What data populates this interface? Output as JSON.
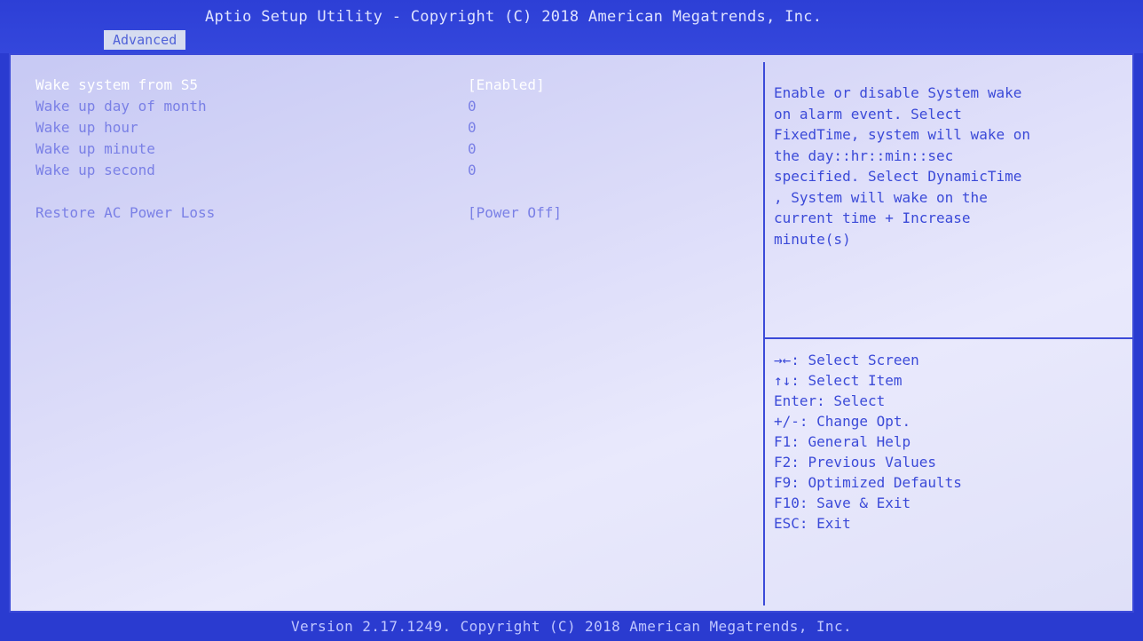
{
  "header": {
    "title": "Aptio Setup Utility - Copyright (C) 2018 American Megatrends, Inc.",
    "active_tab": "Advanced"
  },
  "settings": [
    {
      "label": "Wake system from S5",
      "value": "[Enabled]",
      "selected": true
    },
    {
      "label": "Wake up day of month",
      "value": "0",
      "selected": false
    },
    {
      "label": "Wake up hour",
      "value": "0",
      "selected": false
    },
    {
      "label": "Wake up minute",
      "value": "0",
      "selected": false
    },
    {
      "label": "Wake up second",
      "value": "0",
      "selected": false
    },
    {
      "label": "Restore AC Power Loss",
      "value": "[Power Off]",
      "selected": false
    }
  ],
  "help_lines": [
    "Enable or disable System wake",
    "on alarm event. Select",
    "FixedTime, system will wake on",
    "the day::hr::min::sec",
    "specified. Select DynamicTime",
    ", System will wake on the",
    "current time + Increase",
    "minute(s)"
  ],
  "key_help": [
    "→←: Select Screen",
    "↑↓: Select Item",
    "Enter: Select",
    "+/-: Change Opt.",
    "F1: General Help",
    "F2: Previous Values",
    "F9: Optimized Defaults",
    "F10: Save & Exit",
    "ESC: Exit"
  ],
  "footer": {
    "text": "Version 2.17.1249. Copyright (C) 2018 American Megatrends, Inc."
  },
  "colors": {
    "frame_blue": "#2a3bd0",
    "panel_background": "#dcdcf9",
    "selected_text": "#ffffff",
    "option_text": "#7a80e6",
    "help_text": "#3b4ad8"
  }
}
